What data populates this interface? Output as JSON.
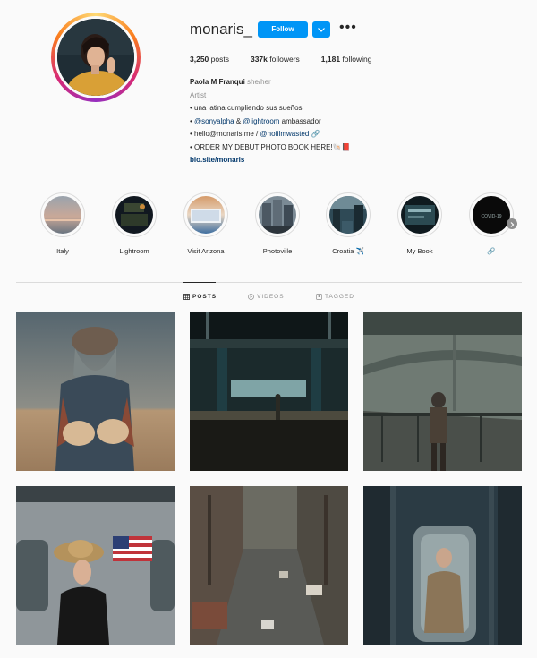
{
  "profile": {
    "username": "monaris_",
    "follow_label": "Follow",
    "more_label": "•••",
    "stats": {
      "posts_count": "3,250",
      "posts_label": " posts",
      "followers_count": "337k",
      "followers_label": " followers",
      "following_count": "1,181",
      "following_label": " following"
    },
    "bio": {
      "name": "Paola M Franqui",
      "pronouns": "she/her",
      "category": "Artist",
      "line1": "• una latina cumpliendo sus sueños",
      "line2_prefix": "• ",
      "line2_mention1": "@sonyalpha",
      "line2_amp": " & ",
      "line2_mention2": "@lightroom",
      "line2_suffix": " ambassador",
      "line3_prefix": "• hello@monaris.me / ",
      "line3_mention": "@nofilmwasted",
      "line3_icon": "🔗",
      "line4": "• ORDER MY DEBUT PHOTO BOOK HERE!🐚📕",
      "link": "bio.site/monaris"
    }
  },
  "highlights": [
    {
      "label": "Italy"
    },
    {
      "label": "Lightroom"
    },
    {
      "label": "Visit Arizona"
    },
    {
      "label": "Photoville"
    },
    {
      "label": "Croatia ✈️"
    },
    {
      "label": "My Book"
    },
    {
      "label": "🔗"
    }
  ],
  "highlight_cover_text": "COVID-19",
  "tabs": {
    "posts": "POSTS",
    "videos": "VIDEOS",
    "tagged": "TAGGED"
  },
  "colors": {
    "accent": "#0095f6",
    "link": "#00376b",
    "muted": "#8e8e8e",
    "border": "#dbdbdb"
  }
}
